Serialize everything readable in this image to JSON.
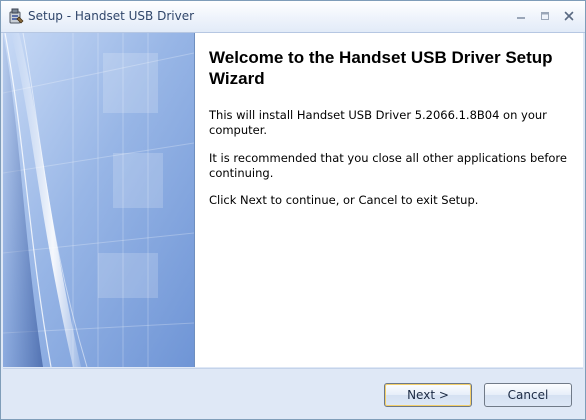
{
  "window": {
    "title": "Setup - Handset USB Driver",
    "icons": {
      "app": "setup-installer-icon",
      "minimize": "minimize-icon",
      "maximize": "maximize-icon",
      "close": "close-icon"
    }
  },
  "wizard": {
    "heading": "Welcome to the Handset USB Driver Setup Wizard",
    "paragraphs": [
      "This will install Handset USB Driver 5.2066.1.8B04 on your computer.",
      "It is recommended that you close all other applications before continuing.",
      "Click Next to continue, or Cancel to exit Setup."
    ]
  },
  "buttons": {
    "next": "Next >",
    "cancel": "Cancel"
  },
  "colors": {
    "title_text": "#30466a",
    "window_bg": "#dfe8f6",
    "panel_blue": "#9cb9e8",
    "border": "#7f9db9"
  }
}
